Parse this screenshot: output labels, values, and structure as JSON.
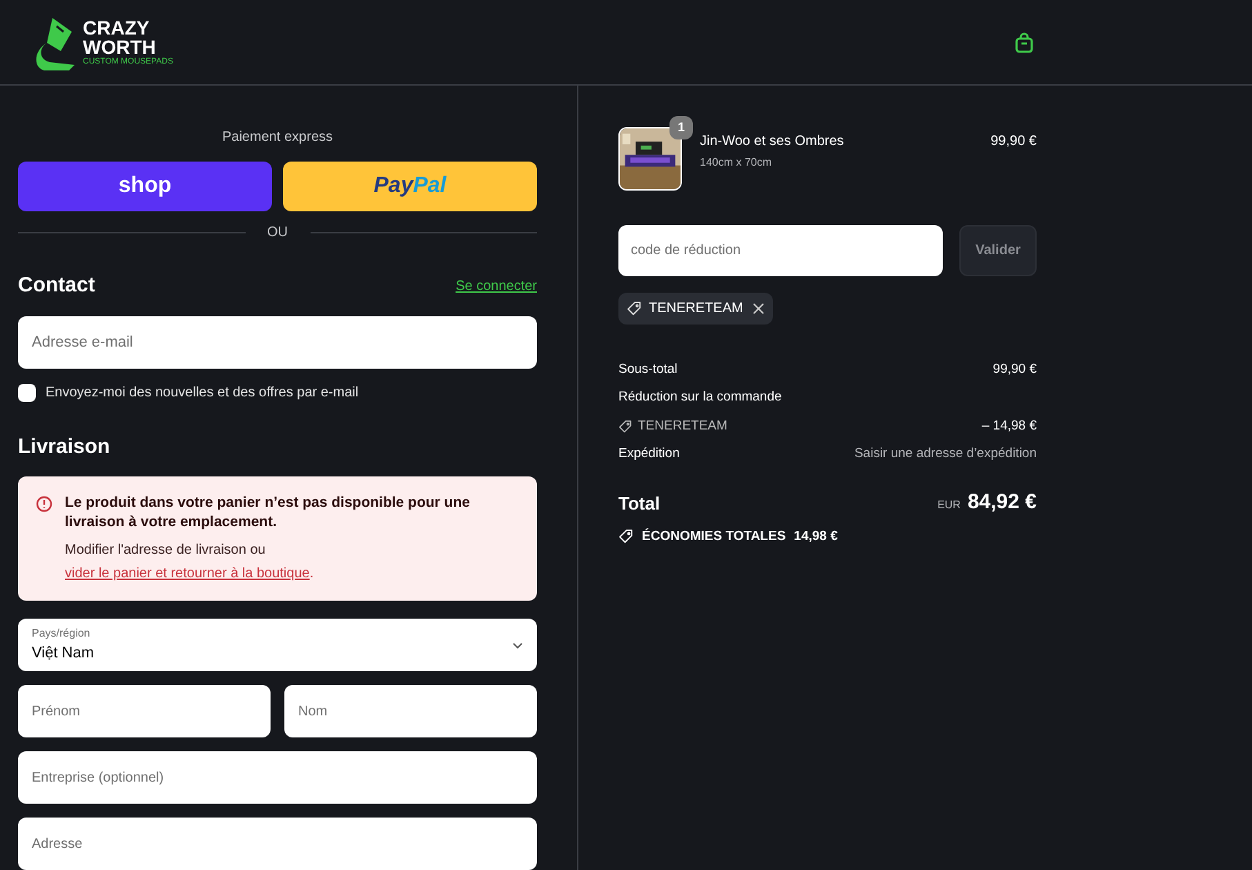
{
  "header": {
    "logo": {
      "line_1": "CRAZY",
      "line_2": "WORTH",
      "tagline": "CUSTOM MOUSEPADS"
    }
  },
  "checkout": {
    "express_label": "Paiement express",
    "express_buttons": [
      {
        "kind": "shop",
        "label": "shop"
      },
      {
        "kind": "paypal",
        "label_1": "Pay",
        "label_2": "Pal"
      }
    ],
    "divider": "OU",
    "contact": {
      "title": "Contact",
      "login_link": "Se connecter",
      "email_placeholder": "Adresse e-mail",
      "newsletter": {
        "label": "Envoyez-moi des nouvelles et des offres par e-mail",
        "checked": false
      }
    },
    "delivery": {
      "title": "Livraison",
      "alert": {
        "title": "Le produit dans votre panier n’est pas disponible pour une livraison à votre emplacement.",
        "text": "Modifier l'adresse de livraison ou",
        "link": "vider le panier et retourner à la boutique",
        "after_link": "."
      },
      "fields": [
        {
          "kind": "select",
          "label": "Pays/région",
          "value": "Việt Nam"
        },
        {
          "kind": "pair",
          "placeholders": [
            "Prénom",
            "Nom"
          ]
        },
        {
          "kind": "text",
          "placeholder": "Entreprise (optionnel)"
        },
        {
          "kind": "text",
          "placeholder": "Adresse"
        }
      ]
    }
  },
  "summary": {
    "items": [
      {
        "quantity": "1",
        "name": "Jin-Woo et ses Ombres",
        "variant": "140cm x 70cm",
        "price": "99,90 €"
      }
    ],
    "discount": {
      "placeholder": "code de réduction",
      "button": "Valider",
      "applied_code": "TENERETEAM"
    },
    "lines": [
      {
        "kind": "plain",
        "label": "Sous-total",
        "value": "99,90 €"
      },
      {
        "kind": "heading",
        "label": "Réduction sur la commande"
      },
      {
        "kind": "code",
        "label": "TENERETEAM",
        "value": "– 14,98 €"
      },
      {
        "kind": "muted_value",
        "label": "Expédition",
        "value": "Saisir une adresse d’expédition"
      }
    ],
    "total": {
      "label": "Total",
      "currency": "EUR",
      "value": "84,92 €"
    },
    "savings": {
      "label": "ÉCONOMIES TOTALES",
      "value": "14,98 €"
    }
  }
}
